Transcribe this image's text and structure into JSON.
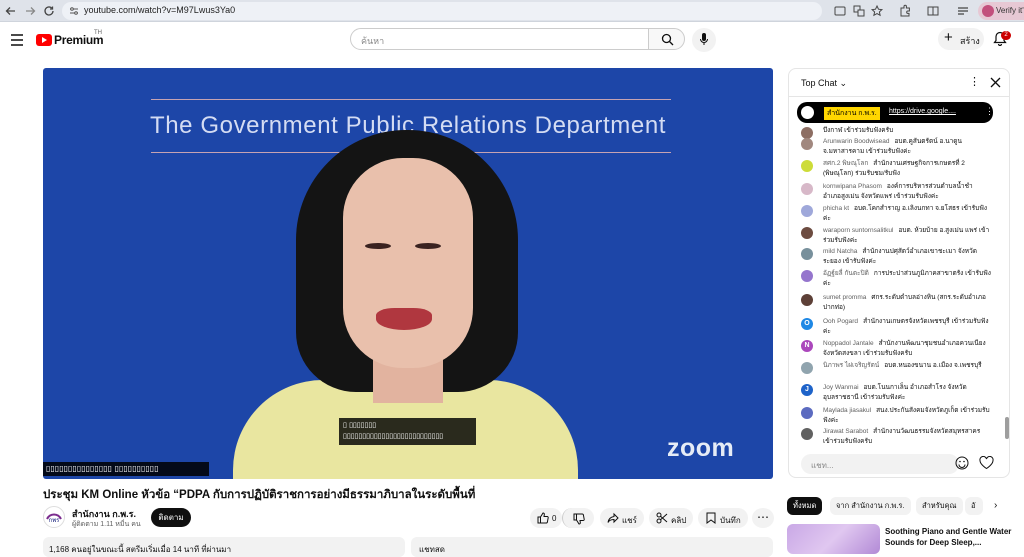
{
  "browser": {
    "url": "youtube.com/watch?v=M97Lwus3Ya0",
    "verify_label": "Verify it's"
  },
  "header": {
    "logo_text": "Premium",
    "logo_sup": "TH",
    "search_placeholder": "ค้นหา",
    "create_label": "สร้าง",
    "notif_count": "2"
  },
  "video": {
    "banner": "The Government Public Relations Department",
    "caption_line1": "▯ ▯▯▯▯▯▯▯",
    "caption_line2": "▯▯▯▯▯▯▯▯▯▯▯▯▯▯▯▯▯▯▯▯▯▯▯▯▯▯",
    "participant_name": "▯▯▯▯▯▯▯▯▯▯▯▯▯▯▯ ▯▯▯▯▯▯▯▯▯▯",
    "watermark": "zoom"
  },
  "title": "ประชุม KM Online หัวข้อ “PDPA กับการปฏิบัติราชการอย่างมีธรรมาภิบาลในระดับพื้นที่",
  "channel": {
    "name": "สำนักงาน ก.พ.ร.",
    "subs": "ผู้ติดตาม 1.11 หมื่น คน",
    "subscribe": "ติดตาม"
  },
  "actions": {
    "likes": "0",
    "share": "แชร์",
    "clip": "คลิป",
    "save": "บันทึก"
  },
  "description": {
    "stats": "1,168 คนอยู่ในขณะนี้  สตรีมเริ่มเมื่อ 14 นาที ที่ผ่านมา",
    "chat_label": "แชทสด"
  },
  "chat": {
    "header": "Top Chat",
    "pinned_author": "สำนักงาน ก.พ.ร.",
    "pinned_link": "https://drive.google....",
    "input_placeholder": "แชท...",
    "messages": [
      {
        "author": "",
        "text": "บึงกาฬ เข้าร่วมรับฟังครับ",
        "color": "#8d6e63",
        "initial": ""
      },
      {
        "author": "Arunwarin Boodwisead",
        "text": "อบต.คูสันตรัตน์ อ.นาดูน จ.มหาสารคาม เข้าร่วมรับฟังค่ะ",
        "color": "#a1887f",
        "initial": ""
      },
      {
        "author": "สศก.2 พิษณุโลก",
        "text": "สำนักงานเศรษฐกิจการเกษตรที่ 2 (พิษณุโลก) ร่วมรับชม/รับฟัง",
        "color": "#cddc39",
        "initial": ""
      },
      {
        "author": "kornwipana Phasom",
        "text": "องค์การบริหารส่วนตำบลน้ำชำ อำเภอสูงเม่น จังหวัดแพร่ เข้าร่วมรับฟังค่ะ",
        "color": "#d7b8c8",
        "initial": ""
      },
      {
        "author": "phicha kt",
        "text": "อบต.โคกสำราญ อ.เลิงนกทา จ.ยโสธร เข้ารับฟังค่ะ",
        "color": "#9fa8da",
        "initial": ""
      },
      {
        "author": "waraporn suntornsalitkul",
        "text": "อบต. ห้วยบ้าย อ.สูงเม่น แพร่ เข้าร่วมรับฟังค่ะ",
        "color": "#6d4c41",
        "initial": ""
      },
      {
        "author": "mild Natcha",
        "text": "สำนักงานปศุสัตว์อำเภอเขาชะเมา จังหวัดระยอง เข้ารับฟังค่ะ",
        "color": "#78909c",
        "initial": ""
      },
      {
        "author": "อัฏฐ์ยลี่ กันตะปิติ",
        "text": "การประปาส่วนภูมิภาคสาขาตรัง เข้ารับฟังค่ะ",
        "color": "#9575cd",
        "initial": ""
      },
      {
        "author": "sumet promma",
        "text": "ศกร.ระดับตำบลอ่างหิน (สกร.ระดับอำเภอปากท่อ)",
        "color": "#5d4037",
        "initial": ""
      },
      {
        "author": "Ooh Pogard",
        "text": "สำนักงานเกษตรจังหวัดเพชรบุรี เข้าร่วมรับฟังค่ะ",
        "color": "#1e88e5",
        "initial": "O"
      },
      {
        "author": "Noppadol Jantale",
        "text": "สำนักงานพัฒนาชุมชนอำเภอควนเนียง จังหวัดสงขลา เข้าร่วมรับฟังครับ",
        "color": "#ab47bc",
        "initial": "N"
      },
      {
        "author": "นิภาพร ไผ่เจริญรัตน์",
        "text": "อบต.หนองขนาน อ.เมือง จ.เพชรบุรี",
        "color": "#90a4ae",
        "initial": ""
      },
      {
        "author": "Joy Wanmai",
        "text": "อบต.โนนกาเล็น อำเภอสำโรง จังหวัดอุบลราชธานี เข้าร่วมรับฟังค่ะ",
        "color": "#1e63c9",
        "initial": "J"
      },
      {
        "author": "Maylada jiasakul",
        "text": "สนง.ประกันสังคมจังหวัดภูเก็ต เข้าร่วมรับฟังค่ะ",
        "color": "#5c6bc0",
        "initial": ""
      },
      {
        "author": "Jirawat Sarabot",
        "text": "สำนักงานวัฒนธรรมจังหวัดสมุทรสาคร เข้าร่วมรับฟังครับ",
        "color": "#616161",
        "initial": ""
      }
    ]
  },
  "chips": [
    "ทั้งหมด",
    "จาก สำนักงาน ก.พ.ร.",
    "สำหรับคุณ",
    "อั"
  ],
  "recommendation": {
    "title": "Soothing Piano and Gentle Water Sounds for Deep Sleep,..."
  }
}
